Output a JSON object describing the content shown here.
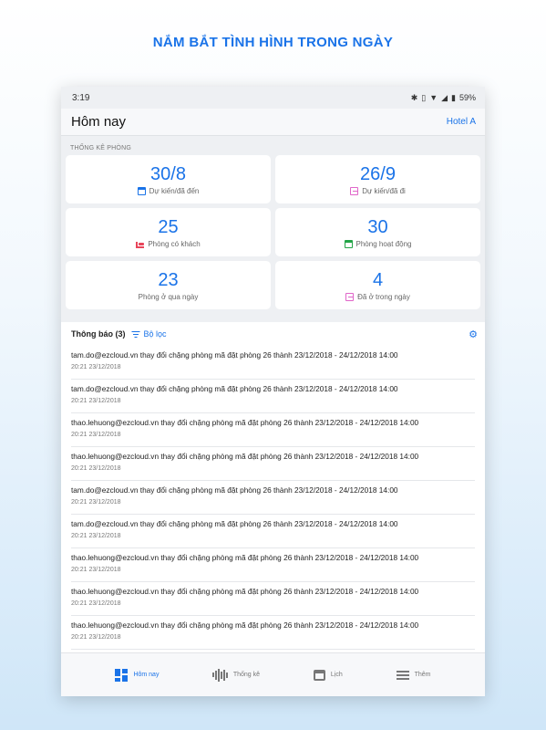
{
  "headline": "NẮM BẮT TÌNH HÌNH TRONG NGÀY",
  "status_bar": {
    "time": "3:19",
    "battery": "59%"
  },
  "app_bar": {
    "title": "Hôm nay",
    "hotel": "Hotel A"
  },
  "stats": {
    "section_label": "THỐNG KÊ PHÒNG",
    "cards": [
      {
        "value": "30/8",
        "label": "Dự kiến/đã đến",
        "icon": "calendar-icon",
        "icon_color": "#1a73e8"
      },
      {
        "value": "26/9",
        "label": "Dự kiến/đã đi",
        "icon": "checkout-icon",
        "icon_color": "#e066c9"
      },
      {
        "value": "25",
        "label": "Phòng có khách",
        "icon": "bed-icon",
        "icon_color": "#e8455a"
      },
      {
        "value": "30",
        "label": "Phòng hoạt động",
        "icon": "calendar-check-icon",
        "icon_color": "#23a447"
      },
      {
        "value": "23",
        "label": "Phòng ở qua ngày",
        "icon": "",
        "icon_color": ""
      },
      {
        "value": "4",
        "label": "Đã ở trong ngày",
        "icon": "checkout-icon",
        "icon_color": "#e066c9"
      }
    ]
  },
  "notifications": {
    "title": "Thông báo (3)",
    "filter_label": "Bộ lọc",
    "items": [
      {
        "message": "tam.do@ezcloud.vn thay đổi chặng phòng mã đặt phòng 26 thành 23/12/2018 - 24/12/2018 14:00",
        "time": "20:21 23/12/2018"
      },
      {
        "message": "tam.do@ezcloud.vn thay đổi chặng phòng mã đặt phòng 26 thành 23/12/2018 - 24/12/2018 14:00",
        "time": "20:21 23/12/2018"
      },
      {
        "message": "thao.lehuong@ezcloud.vn thay đổi chặng phòng mã đặt phòng 26 thành 23/12/2018 - 24/12/2018 14:00",
        "time": "20:21 23/12/2018"
      },
      {
        "message": "thao.lehuong@ezcloud.vn thay đổi chặng phòng mã đặt phòng 26 thành 23/12/2018 - 24/12/2018 14:00",
        "time": "20:21 23/12/2018"
      },
      {
        "message": "tam.do@ezcloud.vn thay đổi chặng phòng mã đặt phòng 26 thành 23/12/2018 - 24/12/2018 14:00",
        "time": "20:21 23/12/2018"
      },
      {
        "message": "tam.do@ezcloud.vn thay đổi chặng phòng mã đặt phòng 26 thành 23/12/2018 - 24/12/2018 14:00",
        "time": "20:21 23/12/2018"
      },
      {
        "message": "thao.lehuong@ezcloud.vn thay đổi chặng phòng mã đặt phòng 26 thành 23/12/2018 - 24/12/2018 14:00",
        "time": "20:21 23/12/2018"
      },
      {
        "message": "thao.lehuong@ezcloud.vn thay đổi chặng phòng mã đặt phòng 26 thành 23/12/2018 - 24/12/2018 14:00",
        "time": "20:21 23/12/2018"
      },
      {
        "message": "thao.lehuong@ezcloud.vn thay đổi chặng phòng mã đặt phòng 26 thành 23/12/2018 - 24/12/2018 14:00",
        "time": "20:21 23/12/2018"
      }
    ]
  },
  "bottom_nav": [
    {
      "label": "Hôm nay",
      "icon": "dashboard-icon",
      "active": true
    },
    {
      "label": "Thống kê",
      "icon": "waveform-icon",
      "active": false
    },
    {
      "label": "Lịch",
      "icon": "calendar-icon",
      "active": false
    },
    {
      "label": "Thêm",
      "icon": "menu-icon",
      "active": false
    }
  ]
}
